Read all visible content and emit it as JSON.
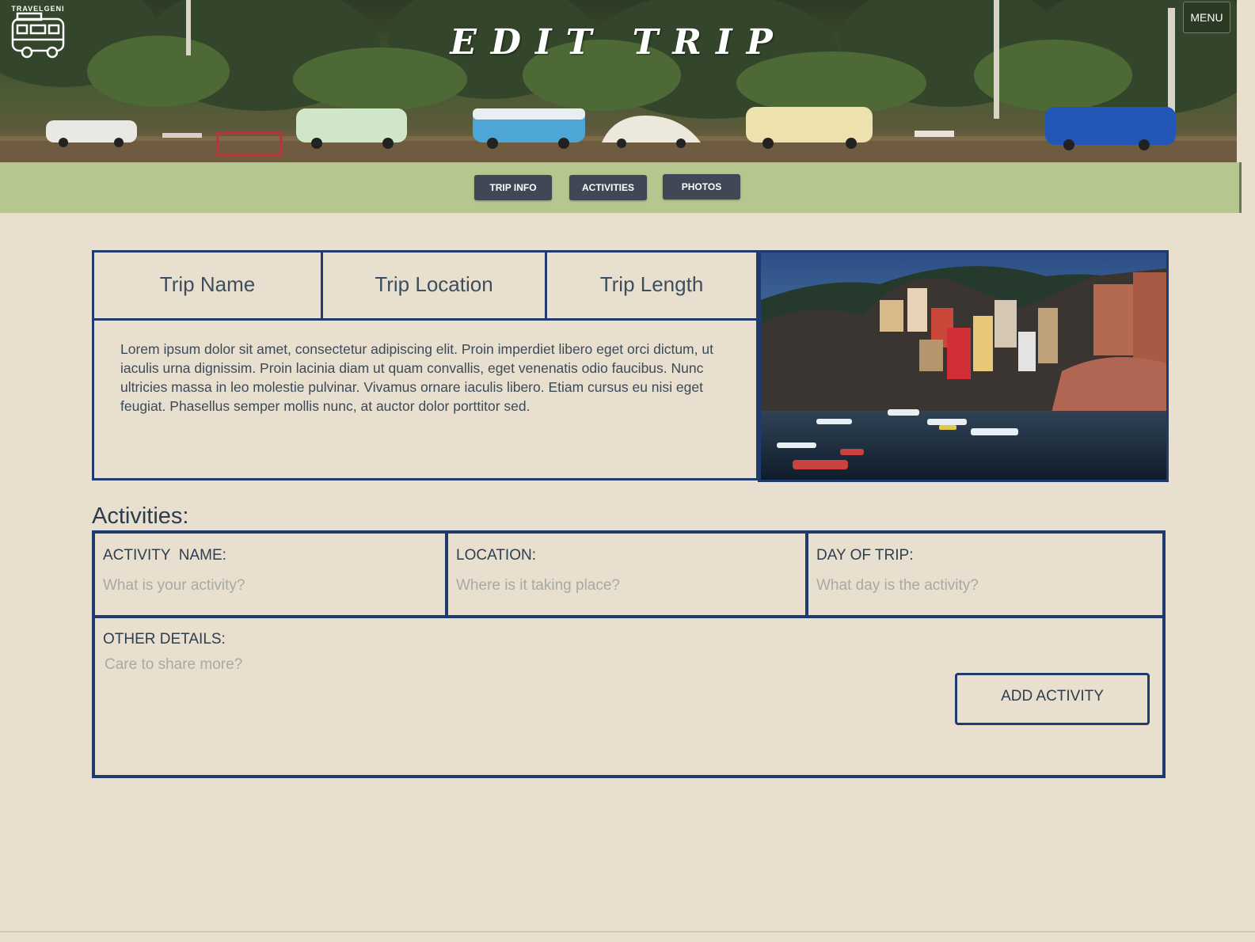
{
  "header": {
    "logo_text": "TRAVELGENI",
    "title": "EDIT TRIP",
    "menu_label": "MENU"
  },
  "nav": {
    "tabs": [
      {
        "label": "TRIP INFO"
      },
      {
        "label": "ACTIVITIES"
      },
      {
        "label": "PHOTOS"
      }
    ]
  },
  "trip": {
    "name_label": "Trip Name",
    "location_label": "Trip Location",
    "length_label": "Trip Length",
    "description": "Lorem ipsum dolor sit amet, consectetur adipiscing elit. Proin imperdiet libero eget orci dictum, ut iaculis urna dignissim. Proin lacinia diam ut quam convallis, eget venenatis odio faucibus. Nunc ultricies massa in leo molestie pulvinar. Vivamus ornare iaculis libero. Etiam cursus eu nisi eget feugiat. Phasellus semper mollis nunc, at auctor dolor porttitor sed."
  },
  "activities": {
    "heading": "Activities:",
    "activity_name": {
      "label": "ACTIVITY  NAME:",
      "placeholder": "What is your activity?"
    },
    "location": {
      "label": "LOCATION:",
      "placeholder": "Where is it taking place?"
    },
    "day_of_trip": {
      "label": "DAY OF TRIP:",
      "placeholder": "What day is the activity?"
    },
    "other_details": {
      "label": "OTHER DETAILS:",
      "placeholder": "Care to share more?"
    },
    "add_button_label": "ADD ACTIVITY"
  },
  "colors": {
    "background": "#e8dfcf",
    "nav_bar": "#b5c78f",
    "nav_button": "#404855",
    "border_accent": "#1f3a6e"
  }
}
